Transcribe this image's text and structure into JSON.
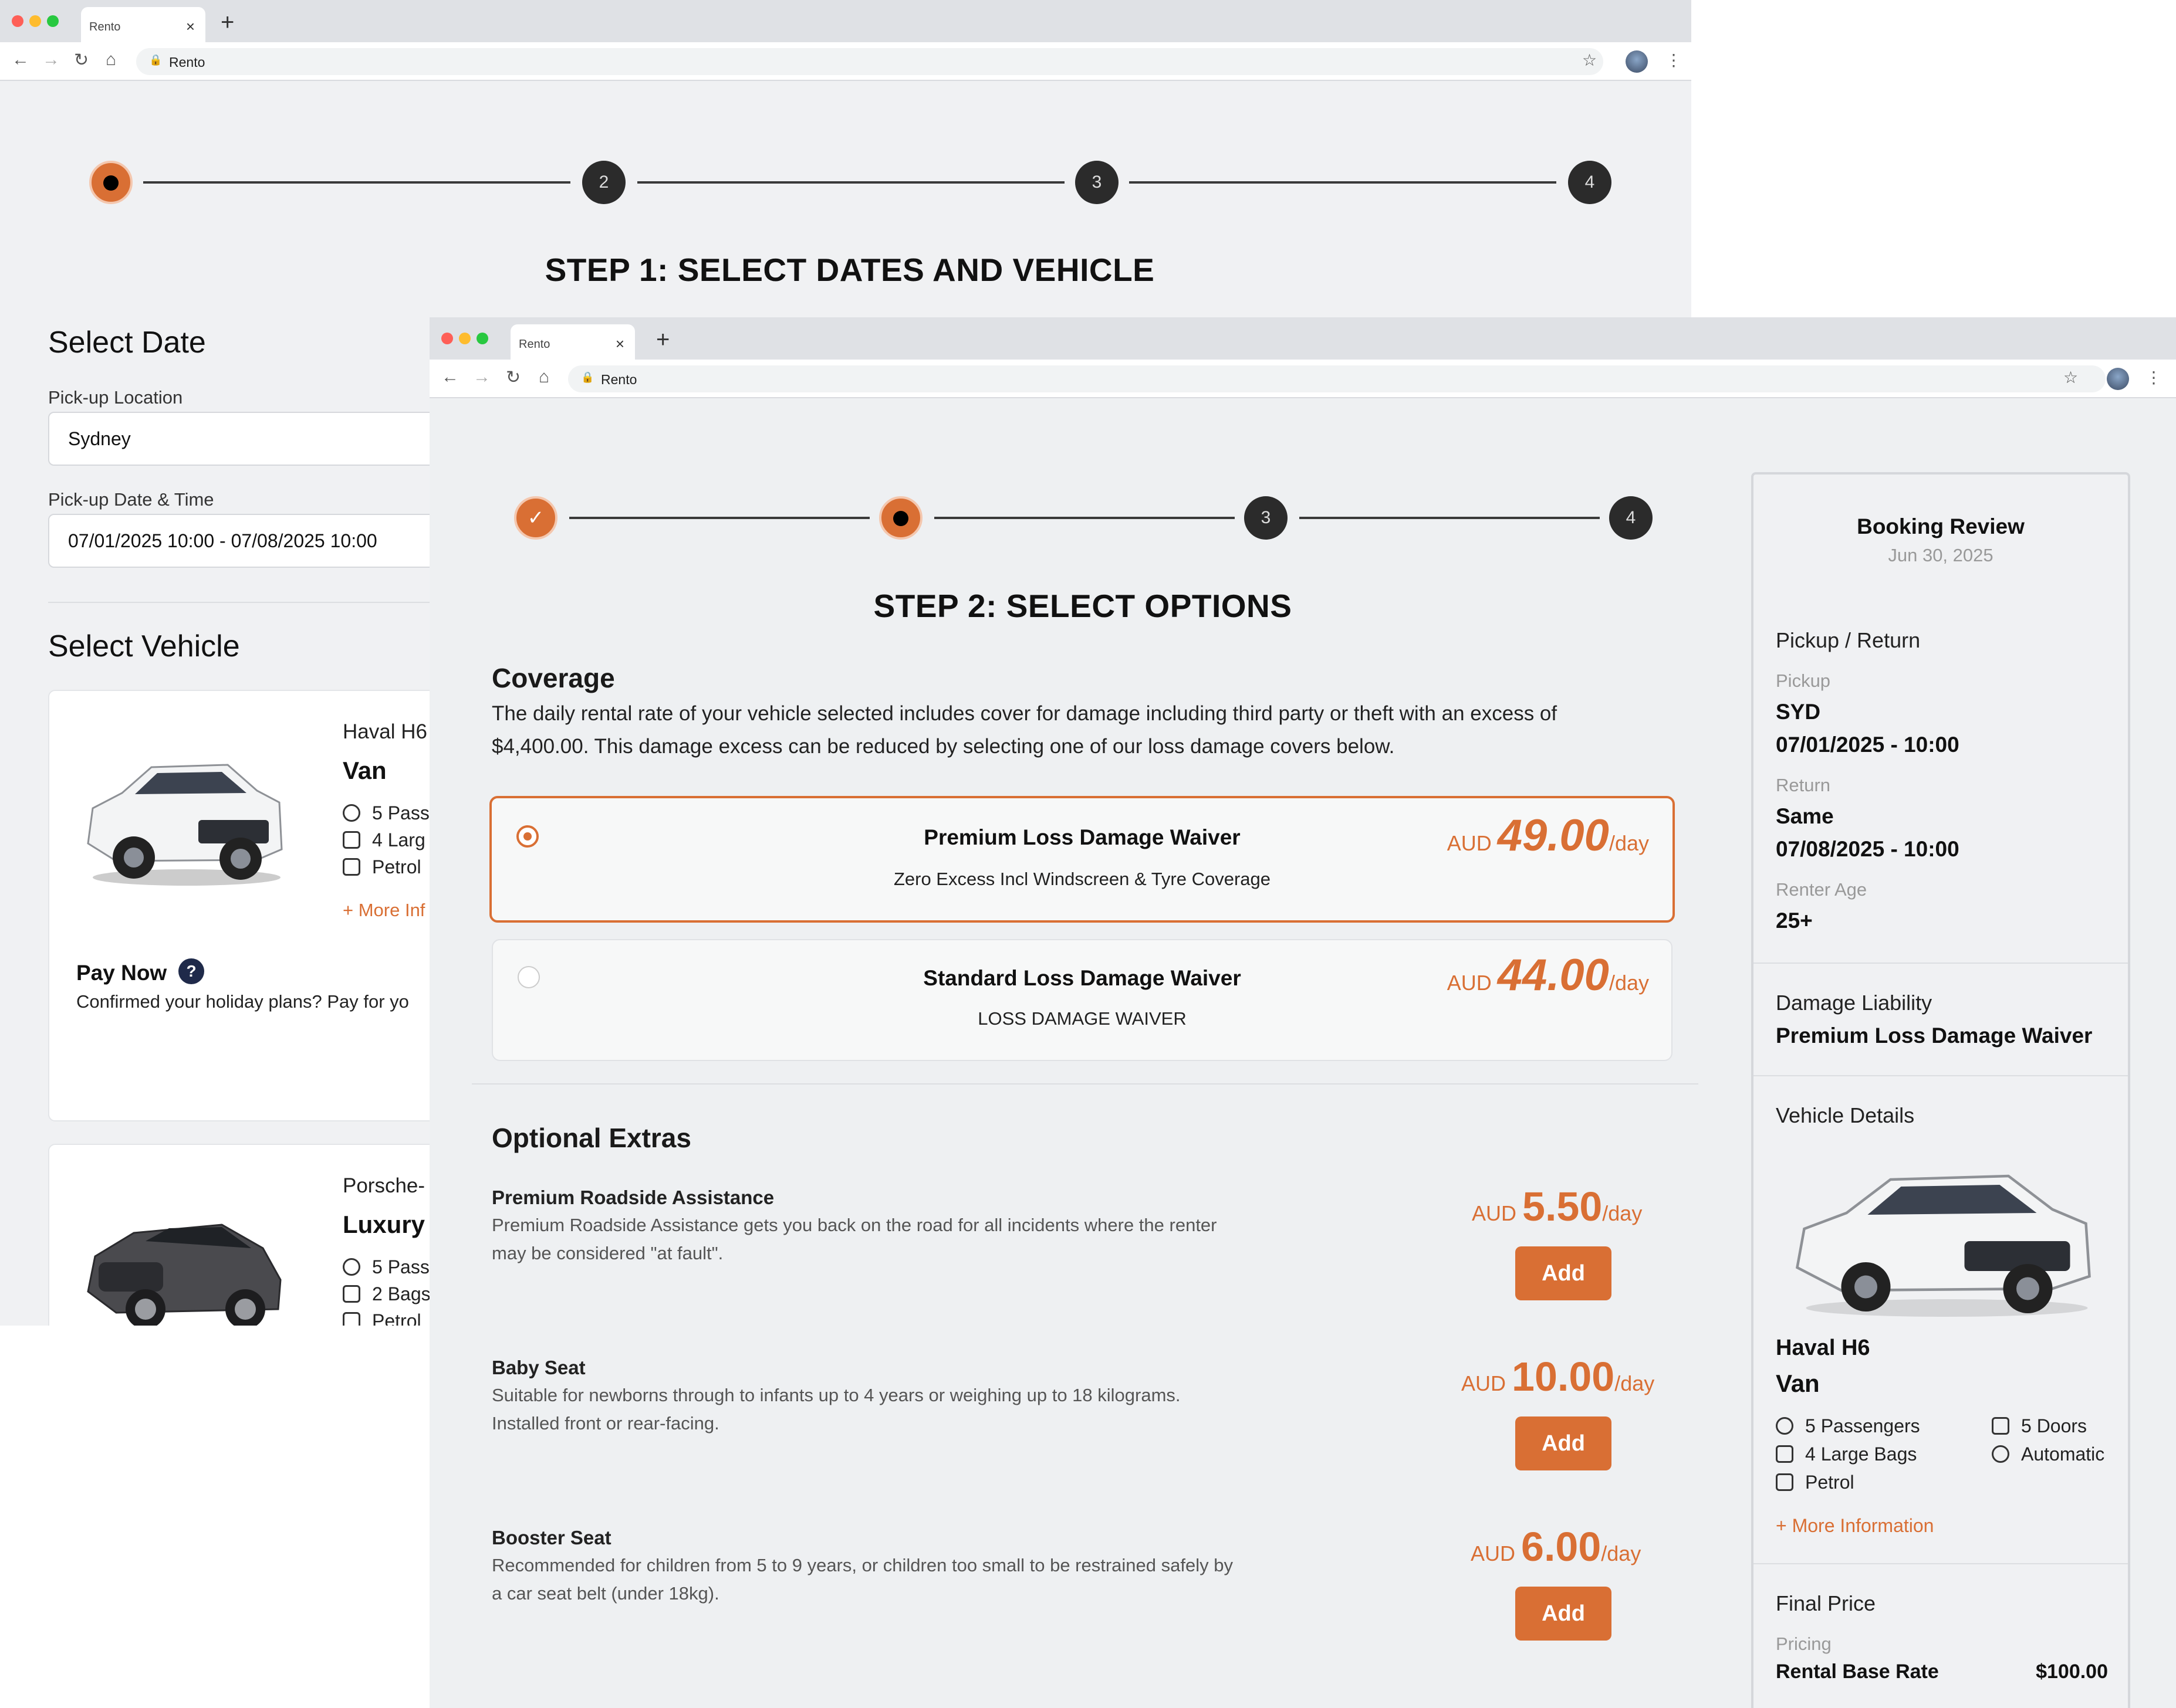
{
  "browser": {
    "tab_title": "Rento",
    "url": "Rento",
    "tab_close": "×",
    "new_tab": "+"
  },
  "back_window": {
    "steps": [
      "",
      "2",
      "3",
      "4"
    ],
    "title": "STEP 1: SELECT DATES AND VEHICLE",
    "select_date_heading": "Select Date",
    "pickup_location_label": "Pick-up Location",
    "pickup_location_value": "Sydney",
    "pickup_datetime_label": "Pick-up Date & Time",
    "pickup_datetime_value": "07/01/2025 10:00 - 07/08/2025 10:00",
    "select_vehicle_heading": "Select Vehicle",
    "vehicles": [
      {
        "name": "Haval H6",
        "type": "Van",
        "features": [
          "5 Pass",
          "4 Larg",
          "Petrol"
        ],
        "more_info": "+ More Inf"
      },
      {
        "name": "Porsche-",
        "type": "Luxury",
        "features": [
          "5 Pass",
          "2 Bags",
          "Petrol"
        ]
      }
    ],
    "pay_now_label": "Pay Now",
    "pay_now_help": "?",
    "pay_now_text": "Confirmed your holiday plans? Pay for yo"
  },
  "front_window": {
    "steps": [
      "✓",
      "",
      "3",
      "4"
    ],
    "title": "STEP 2: SELECT OPTIONS",
    "coverage": {
      "heading": "Coverage",
      "description_line1": "The daily rental rate of your vehicle selected includes cover for damage including third party or theft with an excess of",
      "description_line2": "$4,400.00. This damage excess can be reduced by selecting one of our loss damage covers below.",
      "options": [
        {
          "title": "Premium Loss Damage Waiver",
          "subtitle": "Zero Excess Incl Windscreen & Tyre Coverage",
          "currency": "AUD",
          "amount": "49.00",
          "unit": "/day",
          "selected": true
        },
        {
          "title": "Standard Loss Damage Waiver",
          "subtitle": "LOSS DAMAGE WAIVER",
          "currency": "AUD",
          "amount": "44.00",
          "unit": "/day",
          "selected": false
        }
      ]
    },
    "extras": {
      "heading": "Optional Extras",
      "items": [
        {
          "title": "Premium Roadside Assistance",
          "desc1": "Premium Roadside Assistance gets you back on the road for all incidents where the renter",
          "desc2": "may be considered \"at fault\".",
          "currency": "AUD",
          "amount": "5.50",
          "unit": "/day",
          "button": "Add"
        },
        {
          "title": "Baby Seat",
          "desc1": "Suitable for newborns through to infants up to 4 years or weighing up to 18 kilograms.",
          "desc2": "Installed front or rear-facing.",
          "currency": "AUD",
          "amount": "10.00",
          "unit": "/day",
          "button": "Add"
        },
        {
          "title": "Booster Seat",
          "desc1": "Recommended for children from 5 to 9 years, or children too small to be restrained safely by",
          "desc2": "a car seat belt (under 18kg).",
          "currency": "AUD",
          "amount": "6.00",
          "unit": "/day",
          "button": "Add"
        }
      ]
    },
    "review": {
      "heading": "Booking Review",
      "date": "Jun 30, 2025",
      "pickup_return_heading": "Pickup / Return",
      "pickup_label": "Pickup",
      "pickup_location": "SYD",
      "pickup_datetime": "07/01/2025 - 10:00",
      "return_label": "Return",
      "return_location": "Same",
      "return_datetime": "07/08/2025 - 10:00",
      "renter_age_label": "Renter Age",
      "renter_age": "25+",
      "damage_heading": "Damage Liability",
      "damage_value": "Premium Loss Damage Waiver",
      "vehicle_heading": "Vehicle Details",
      "vehicle_name": "Haval H6",
      "vehicle_type": "Van",
      "features": [
        "5 Passengers",
        "5 Doors",
        "4 Large Bags",
        "Automatic",
        "Petrol"
      ],
      "more_info": "+ More Information",
      "final_price_heading": "Final Price",
      "pricing_label": "Pricing",
      "base_rate_label": "Rental Base Rate",
      "base_rate_value": "$100.00"
    }
  },
  "colors": {
    "accent": "#d96f34",
    "step_dark": "#2b2b2b",
    "page_bg": "#eef0f2"
  }
}
